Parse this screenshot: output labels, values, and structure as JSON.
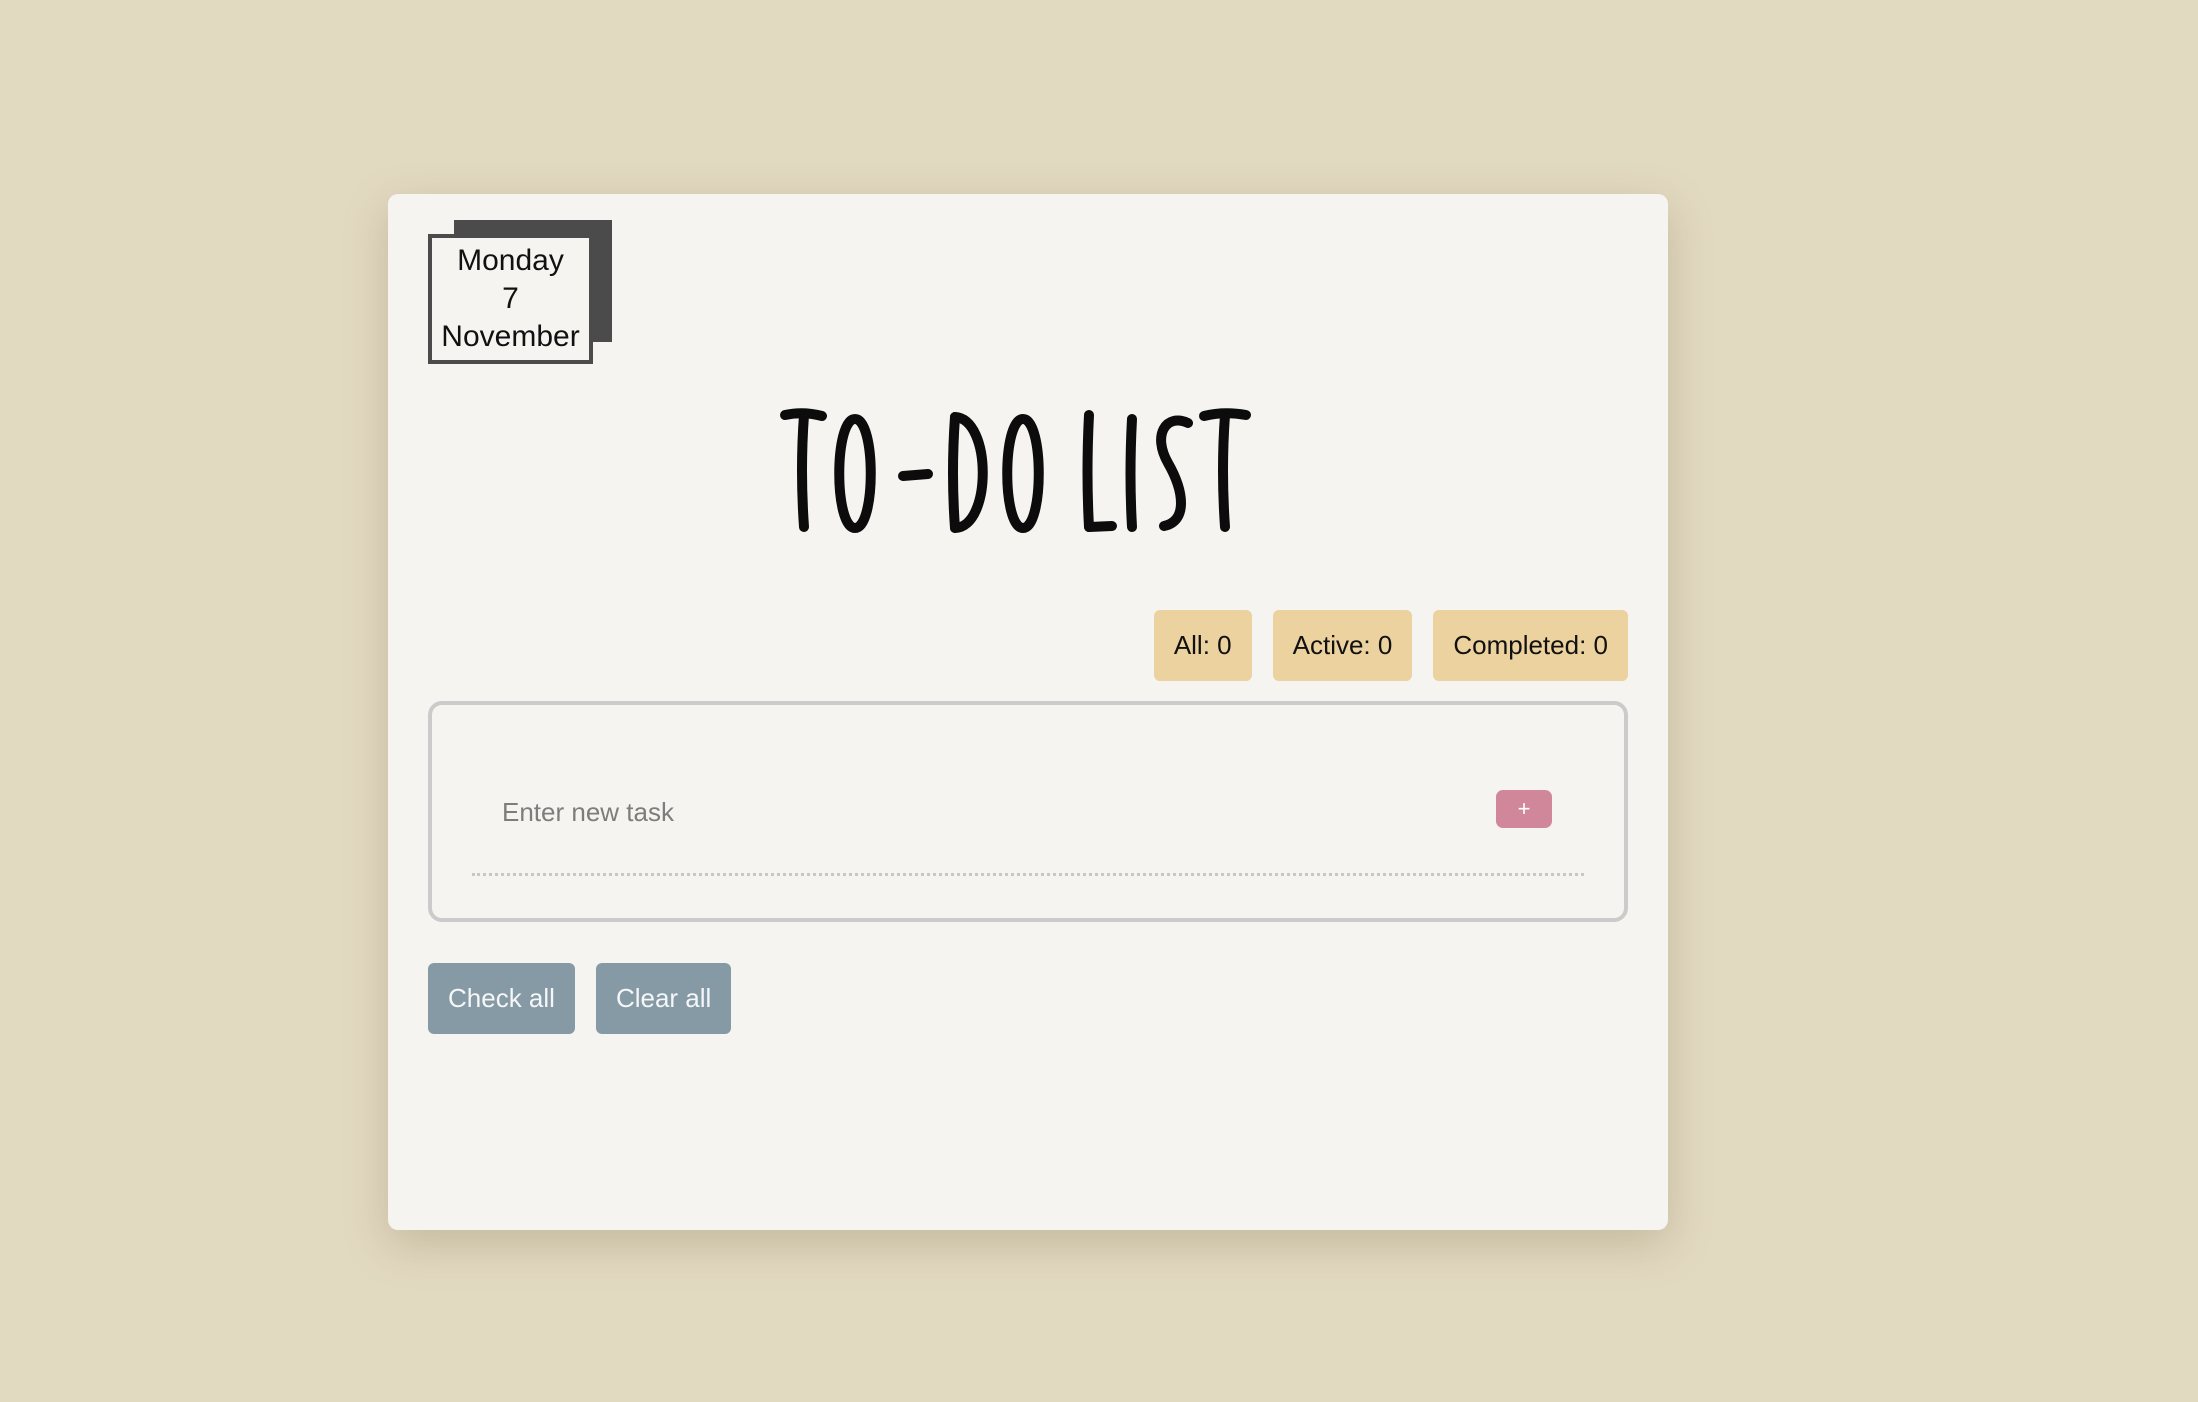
{
  "date": {
    "weekday": "Monday",
    "day": "7",
    "month": "November"
  },
  "title": "TO-DO LIST",
  "counters": {
    "all": "All: 0",
    "active": "Active: 0",
    "completed": "Completed: 0"
  },
  "task_input": {
    "value": "",
    "placeholder": "Enter new task"
  },
  "add_button_label": "+",
  "actions": {
    "check_all": "Check all",
    "clear_all": "Clear all"
  },
  "colors": {
    "background": "#e2d9c1",
    "card": "#f6f4f1",
    "counter_badge": "#ecd29e",
    "add_button": "#d0879a",
    "action_button": "#869aa6",
    "date_shadow": "#4b4b4b"
  }
}
